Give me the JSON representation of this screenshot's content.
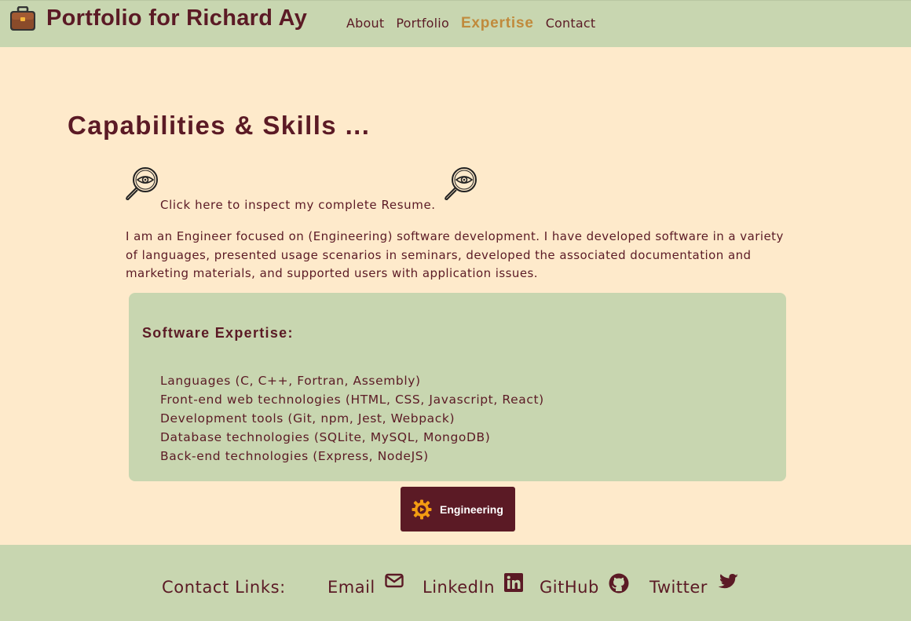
{
  "header": {
    "brand_icon": "briefcase-icon",
    "title": "Portfolio for Richard Ay",
    "nav": [
      {
        "label": "About",
        "active": false
      },
      {
        "label": "Portfolio",
        "active": false
      },
      {
        "label": "Expertise",
        "active": true
      },
      {
        "label": "Contact",
        "active": false
      }
    ]
  },
  "main": {
    "heading": "Capabilities & Skills ...",
    "resume_link": "Click here to inspect my complete Resume.",
    "resume_icon": "magnifier-eye-icon",
    "intro": "I am an Engineer focused on (Engineering) software development. I have developed software in a variety of languages, presented usage scenarios in seminars, developed the associated documentation and marketing materials, and supported users with application issues.",
    "expertise": {
      "title": "Software Expertise:",
      "items": [
        "Languages (C, C++, Fortran, Assembly)",
        "Front-end web technologies (HTML, CSS, Javascript, React)",
        "Development tools (Git, npm, Jest, Webpack)",
        "Database technologies (SQLite, MySQL, MongoDB)",
        "Back-end technologies (Express, NodeJS)"
      ]
    },
    "engineering_button": {
      "label": "Engineering",
      "icon": "gear-play-icon"
    }
  },
  "footer": {
    "contact_label": "Contact Links:",
    "links": [
      {
        "label": "Email",
        "icon": "envelope-icon"
      },
      {
        "label": "LinkedIn",
        "icon": "linkedin-icon"
      },
      {
        "label": "GitHub",
        "icon": "github-icon"
      },
      {
        "label": "Twitter",
        "icon": "twitter-icon"
      }
    ]
  },
  "colors": {
    "page_bg": "#feeacb",
    "bar_bg": "#c8d6b0",
    "text": "#5b1a25",
    "active_nav": "#c08a3c",
    "button_bg": "#5b1a25",
    "gear_orange": "#f39c12"
  }
}
